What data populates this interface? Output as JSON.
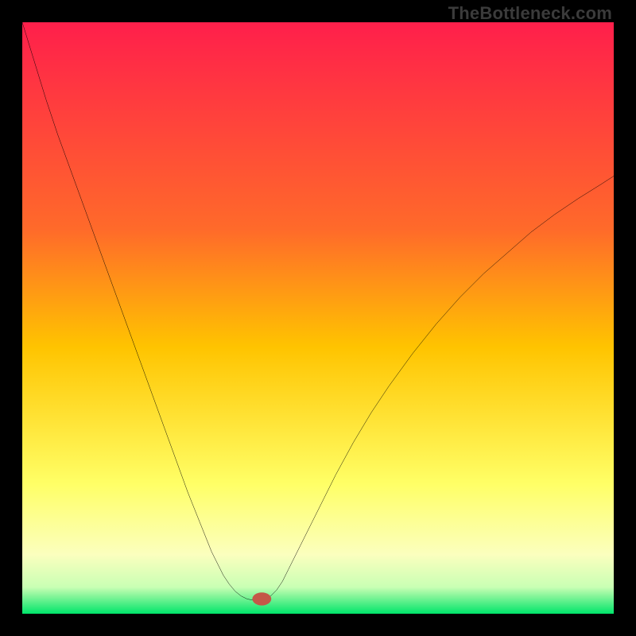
{
  "watermark": "TheBottleneck.com",
  "chart_data": {
    "type": "line",
    "title": "",
    "xlabel": "",
    "ylabel": "",
    "xlim": [
      0,
      100
    ],
    "ylim": [
      0,
      100
    ],
    "grid": false,
    "legend": false,
    "background": {
      "stops": [
        {
          "y": 0,
          "color": "#ff1f4b"
        },
        {
          "y": 35,
          "color": "#ff6a2a"
        },
        {
          "y": 55,
          "color": "#ffc400"
        },
        {
          "y": 78,
          "color": "#ffff66"
        },
        {
          "y": 90,
          "color": "#fbffbe"
        },
        {
          "y": 95.5,
          "color": "#c9ffb4"
        },
        {
          "y": 97,
          "color": "#86f59a"
        },
        {
          "y": 100,
          "color": "#00e56a"
        }
      ]
    },
    "marker": {
      "x": 40.5,
      "y": 97.5,
      "rx": 1.6,
      "ry": 1.1,
      "color": "#c45848"
    },
    "series": [
      {
        "name": "bottleneck-curve",
        "color": "#000000",
        "x": [
          0,
          2,
          4,
          6,
          8,
          10,
          12,
          14,
          16,
          18,
          20,
          22,
          24,
          26,
          28,
          30,
          32,
          34,
          35,
          36,
          37,
          38,
          39,
          40,
          41,
          42,
          43,
          44,
          45,
          47,
          49,
          51,
          53,
          56,
          59,
          62,
          66,
          70,
          74,
          78,
          82,
          86,
          90,
          94,
          98,
          100
        ],
        "y": [
          0,
          6.5,
          13,
          19,
          24.5,
          30,
          35.5,
          41,
          46.5,
          52,
          57.5,
          63,
          68.5,
          74,
          79.5,
          84.5,
          89.5,
          93.5,
          95,
          96.2,
          97,
          97.5,
          97.7,
          97.7,
          97.5,
          97,
          96,
          94.5,
          92.5,
          88.5,
          84.5,
          80.5,
          76.5,
          71,
          66,
          61.5,
          56,
          51,
          46.5,
          42.5,
          39,
          35.5,
          32.5,
          29.8,
          27.3,
          26
        ]
      }
    ]
  }
}
